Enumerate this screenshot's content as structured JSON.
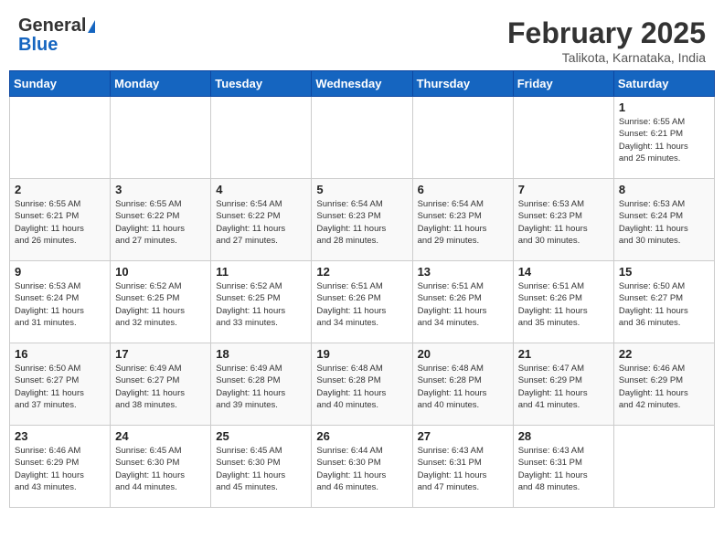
{
  "header": {
    "logo_general": "General",
    "logo_blue": "Blue",
    "month_title": "February 2025",
    "location": "Talikota, Karnataka, India"
  },
  "days_of_week": [
    "Sunday",
    "Monday",
    "Tuesday",
    "Wednesday",
    "Thursday",
    "Friday",
    "Saturday"
  ],
  "weeks": [
    [
      {
        "day": "",
        "info": ""
      },
      {
        "day": "",
        "info": ""
      },
      {
        "day": "",
        "info": ""
      },
      {
        "day": "",
        "info": ""
      },
      {
        "day": "",
        "info": ""
      },
      {
        "day": "",
        "info": ""
      },
      {
        "day": "1",
        "info": "Sunrise: 6:55 AM\nSunset: 6:21 PM\nDaylight: 11 hours\nand 25 minutes."
      }
    ],
    [
      {
        "day": "2",
        "info": "Sunrise: 6:55 AM\nSunset: 6:21 PM\nDaylight: 11 hours\nand 26 minutes."
      },
      {
        "day": "3",
        "info": "Sunrise: 6:55 AM\nSunset: 6:22 PM\nDaylight: 11 hours\nand 27 minutes."
      },
      {
        "day": "4",
        "info": "Sunrise: 6:54 AM\nSunset: 6:22 PM\nDaylight: 11 hours\nand 27 minutes."
      },
      {
        "day": "5",
        "info": "Sunrise: 6:54 AM\nSunset: 6:23 PM\nDaylight: 11 hours\nand 28 minutes."
      },
      {
        "day": "6",
        "info": "Sunrise: 6:54 AM\nSunset: 6:23 PM\nDaylight: 11 hours\nand 29 minutes."
      },
      {
        "day": "7",
        "info": "Sunrise: 6:53 AM\nSunset: 6:23 PM\nDaylight: 11 hours\nand 30 minutes."
      },
      {
        "day": "8",
        "info": "Sunrise: 6:53 AM\nSunset: 6:24 PM\nDaylight: 11 hours\nand 30 minutes."
      }
    ],
    [
      {
        "day": "9",
        "info": "Sunrise: 6:53 AM\nSunset: 6:24 PM\nDaylight: 11 hours\nand 31 minutes."
      },
      {
        "day": "10",
        "info": "Sunrise: 6:52 AM\nSunset: 6:25 PM\nDaylight: 11 hours\nand 32 minutes."
      },
      {
        "day": "11",
        "info": "Sunrise: 6:52 AM\nSunset: 6:25 PM\nDaylight: 11 hours\nand 33 minutes."
      },
      {
        "day": "12",
        "info": "Sunrise: 6:51 AM\nSunset: 6:26 PM\nDaylight: 11 hours\nand 34 minutes."
      },
      {
        "day": "13",
        "info": "Sunrise: 6:51 AM\nSunset: 6:26 PM\nDaylight: 11 hours\nand 34 minutes."
      },
      {
        "day": "14",
        "info": "Sunrise: 6:51 AM\nSunset: 6:26 PM\nDaylight: 11 hours\nand 35 minutes."
      },
      {
        "day": "15",
        "info": "Sunrise: 6:50 AM\nSunset: 6:27 PM\nDaylight: 11 hours\nand 36 minutes."
      }
    ],
    [
      {
        "day": "16",
        "info": "Sunrise: 6:50 AM\nSunset: 6:27 PM\nDaylight: 11 hours\nand 37 minutes."
      },
      {
        "day": "17",
        "info": "Sunrise: 6:49 AM\nSunset: 6:27 PM\nDaylight: 11 hours\nand 38 minutes."
      },
      {
        "day": "18",
        "info": "Sunrise: 6:49 AM\nSunset: 6:28 PM\nDaylight: 11 hours\nand 39 minutes."
      },
      {
        "day": "19",
        "info": "Sunrise: 6:48 AM\nSunset: 6:28 PM\nDaylight: 11 hours\nand 40 minutes."
      },
      {
        "day": "20",
        "info": "Sunrise: 6:48 AM\nSunset: 6:28 PM\nDaylight: 11 hours\nand 40 minutes."
      },
      {
        "day": "21",
        "info": "Sunrise: 6:47 AM\nSunset: 6:29 PM\nDaylight: 11 hours\nand 41 minutes."
      },
      {
        "day": "22",
        "info": "Sunrise: 6:46 AM\nSunset: 6:29 PM\nDaylight: 11 hours\nand 42 minutes."
      }
    ],
    [
      {
        "day": "23",
        "info": "Sunrise: 6:46 AM\nSunset: 6:29 PM\nDaylight: 11 hours\nand 43 minutes."
      },
      {
        "day": "24",
        "info": "Sunrise: 6:45 AM\nSunset: 6:30 PM\nDaylight: 11 hours\nand 44 minutes."
      },
      {
        "day": "25",
        "info": "Sunrise: 6:45 AM\nSunset: 6:30 PM\nDaylight: 11 hours\nand 45 minutes."
      },
      {
        "day": "26",
        "info": "Sunrise: 6:44 AM\nSunset: 6:30 PM\nDaylight: 11 hours\nand 46 minutes."
      },
      {
        "day": "27",
        "info": "Sunrise: 6:43 AM\nSunset: 6:31 PM\nDaylight: 11 hours\nand 47 minutes."
      },
      {
        "day": "28",
        "info": "Sunrise: 6:43 AM\nSunset: 6:31 PM\nDaylight: 11 hours\nand 48 minutes."
      },
      {
        "day": "",
        "info": ""
      }
    ]
  ]
}
